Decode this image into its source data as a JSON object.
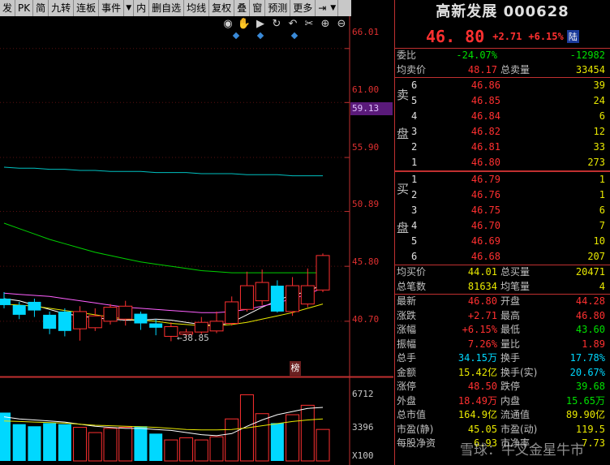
{
  "toolbar": {
    "items": [
      "发",
      "PK",
      "简",
      "九转",
      "连板",
      "事件",
      "内",
      "删自选",
      "均线",
      "复权",
      "叠",
      "窗",
      "预测",
      "更多"
    ],
    "dropdown_glyph": "▼",
    "pin_icon": "pin-icon"
  },
  "chart_tools": {
    "icons": [
      "eye-icon",
      "hand-icon",
      "play-icon",
      "replay-icon",
      "undo-icon",
      "scissors-icon",
      "zoom-in-icon",
      "zoom-out-icon"
    ]
  },
  "chart_data": [
    {
      "type": "candlestick",
      "price_ticks": [
        "66.01",
        "61.00",
        "55.90",
        "50.89",
        "45.80",
        "40.70"
      ],
      "ylim": [
        37.0,
        67.5
      ],
      "current_price_label": "59.13",
      "low_marker_label": "←38.85",
      "event_badge": "榜",
      "candles": [
        {
          "o": 42.8,
          "c": 42.2,
          "h": 43.4,
          "l": 41.9
        },
        {
          "o": 42.2,
          "c": 41.3,
          "h": 42.5,
          "l": 40.9
        },
        {
          "o": 42.5,
          "c": 41.7,
          "h": 42.8,
          "l": 41.1
        },
        {
          "o": 41.3,
          "c": 40.0,
          "h": 41.6,
          "l": 39.5
        },
        {
          "o": 41.6,
          "c": 39.8,
          "h": 41.9,
          "l": 39.3
        },
        {
          "o": 40.0,
          "c": 41.6,
          "h": 42.1,
          "l": 38.9
        },
        {
          "o": 40.1,
          "c": 41.2,
          "h": 41.9,
          "l": 39.8
        },
        {
          "o": 40.7,
          "c": 42.0,
          "h": 42.3,
          "l": 40.4
        },
        {
          "o": 40.9,
          "c": 42.1,
          "h": 42.6,
          "l": 40.3
        },
        {
          "o": 41.4,
          "c": 40.5,
          "h": 41.6,
          "l": 39.9
        },
        {
          "o": 40.5,
          "c": 40.1,
          "h": 40.9,
          "l": 39.4
        },
        {
          "o": 39.3,
          "c": 40.2,
          "h": 40.6,
          "l": 38.85
        },
        {
          "o": 39.5,
          "c": 39.7,
          "h": 40.0,
          "l": 39.1
        },
        {
          "o": 39.7,
          "c": 40.6,
          "h": 41.1,
          "l": 39.5
        },
        {
          "o": 39.8,
          "c": 40.7,
          "h": 41.6,
          "l": 39.6
        },
        {
          "o": 40.5,
          "c": 42.5,
          "h": 43.0,
          "l": 40.3
        },
        {
          "o": 41.8,
          "c": 44.0,
          "h": 45.3,
          "l": 41.6
        },
        {
          "o": 42.6,
          "c": 44.3,
          "h": 45.5,
          "l": 42.2
        },
        {
          "o": 44.0,
          "c": 41.6,
          "h": 44.5,
          "l": 41.5
        },
        {
          "o": 41.6,
          "c": 44.0,
          "h": 44.8,
          "l": 41.2
        },
        {
          "o": 42.3,
          "c": 44.0,
          "h": 45.6,
          "l": 42.0
        },
        {
          "o": 43.6,
          "c": 46.8,
          "h": 47.0,
          "l": 43.4
        }
      ],
      "moving_averages": [
        {
          "name": "MA5",
          "color": "#ffffff",
          "values": [
            42.8,
            42.6,
            42.2,
            41.8,
            41.4,
            41.2,
            41.0,
            40.9,
            40.8,
            40.8,
            40.9,
            40.8,
            40.6,
            40.4,
            40.3,
            40.6,
            41.3,
            42.0,
            42.6,
            43.2,
            43.4,
            44.2
          ]
        },
        {
          "name": "MA10",
          "color": "#e8e800",
          "values": [
            42.3,
            42.2,
            42.1,
            41.9,
            41.7,
            41.5,
            41.3,
            41.1,
            40.9,
            40.8,
            40.7,
            40.5,
            40.4,
            40.3,
            40.3,
            40.4,
            40.6,
            40.9,
            41.2,
            41.5,
            41.9,
            42.3
          ]
        },
        {
          "name": "MA20",
          "color": "#ff60ff",
          "values": [
            43.3,
            43.2,
            43.1,
            43.0,
            42.8,
            42.6,
            42.4,
            42.2,
            42.0,
            41.9,
            41.8,
            41.7,
            41.6,
            41.5,
            41.5,
            41.6,
            41.8,
            42.1,
            42.4,
            42.8,
            43.2,
            43.8
          ]
        },
        {
          "name": "MA60",
          "color": "#00d000",
          "values": [
            49.8,
            49.3,
            48.8,
            48.3,
            47.9,
            47.5,
            47.1,
            46.8,
            46.5,
            46.2,
            46.0,
            45.8,
            45.6,
            45.4,
            45.3,
            45.2,
            45.2,
            45.2,
            45.2,
            45.2,
            45.2,
            45.2
          ]
        },
        {
          "name": "MA120",
          "color": "#00c0c0",
          "values": [
            55.0,
            54.9,
            54.9,
            54.8,
            54.8,
            54.7,
            54.7,
            54.6,
            54.6,
            54.6,
            54.5,
            54.5,
            54.5,
            54.4,
            54.4,
            54.4,
            54.3,
            54.3,
            54.3,
            54.2,
            54.2,
            54.2
          ]
        }
      ]
    },
    {
      "type": "bar",
      "ticks": [
        "6712",
        "3396"
      ],
      "unit_label": "X100",
      "ylim": [
        0,
        7800
      ],
      "values": [
        4600,
        3500,
        3300,
        3600,
        3500,
        3200,
        2700,
        3100,
        3200,
        3300,
        2600,
        2000,
        2200,
        2000,
        2300,
        4000,
        6300,
        4500,
        3600,
        4400,
        5300,
        3000
      ],
      "ma_lines": [
        {
          "color": "#ffffff",
          "values": [
            4200,
            4000,
            3900,
            3800,
            3700,
            3500,
            3300,
            3200,
            3100,
            3100,
            3000,
            2900,
            2700,
            2500,
            2400,
            2600,
            3300,
            3900,
            4400,
            4700,
            5000,
            5100
          ]
        },
        {
          "color": "#e8e800",
          "values": [
            3800,
            3750,
            3700,
            3650,
            3600,
            3500,
            3400,
            3350,
            3300,
            3250,
            3200,
            3100,
            3000,
            2950,
            2950,
            3000,
            3150,
            3350,
            3550,
            3750,
            3900,
            4000
          ]
        }
      ]
    }
  ],
  "stock": {
    "name": "高新发展",
    "code": "000628",
    "last_price": "46. 80",
    "change": "+2.71",
    "change_pct": "+6.15%",
    "market_badge": "陆"
  },
  "summary_rows": [
    {
      "label": "委比",
      "value1": "-24.07%",
      "label2": "",
      "value2": "-12982"
    },
    {
      "label": "均卖价",
      "value1": "48.17",
      "label2": "总卖量",
      "value2": "33454"
    }
  ],
  "sell_label": [
    "卖",
    "盘"
  ],
  "buy_label": [
    "买",
    "盘"
  ],
  "sell_orders": [
    {
      "level": "6",
      "price": "46.86",
      "volume": "39"
    },
    {
      "level": "5",
      "price": "46.85",
      "volume": "24"
    },
    {
      "level": "4",
      "price": "46.84",
      "volume": "6"
    },
    {
      "level": "3",
      "price": "46.82",
      "volume": "12"
    },
    {
      "level": "2",
      "price": "46.81",
      "volume": "33"
    },
    {
      "level": "1",
      "price": "46.80",
      "volume": "273"
    }
  ],
  "buy_orders": [
    {
      "level": "1",
      "price": "46.79",
      "volume": "1"
    },
    {
      "level": "2",
      "price": "46.76",
      "volume": "1"
    },
    {
      "level": "3",
      "price": "46.75",
      "volume": "6"
    },
    {
      "level": "4",
      "price": "46.70",
      "volume": "7"
    },
    {
      "level": "5",
      "price": "46.69",
      "volume": "10"
    },
    {
      "level": "6",
      "price": "46.68",
      "volume": "207"
    }
  ],
  "buy_summary": [
    {
      "label": "均买价",
      "value1": "44.01",
      "label2": "总买量",
      "value2": "20471"
    },
    {
      "label": "总笔数",
      "value1": "81634",
      "label2": "均笔量",
      "value2": "4"
    }
  ],
  "stats": [
    {
      "label": "最新",
      "value1": "46.80",
      "label2": "开盘",
      "value2": "44.28"
    },
    {
      "label": "涨跌",
      "value1": "+2.71",
      "label2": "最高",
      "value2": "46.80"
    },
    {
      "label": "涨幅",
      "value1": "+6.15%",
      "label2": "最低",
      "value2": "43.60"
    },
    {
      "label": "振幅",
      "value1": "7.26%",
      "label2": "量比",
      "value2": "1.89"
    },
    {
      "label": "总手",
      "value1": "34.15万",
      "label2": "换手",
      "value2": "17.78%"
    },
    {
      "label": "金额",
      "value1": "15.42亿",
      "label2": "换手(实)",
      "value2": "20.67%"
    },
    {
      "label": "涨停",
      "value1": "48.50",
      "label2": "跌停",
      "value2": "39.68"
    },
    {
      "label": "外盘",
      "value1": "18.49万",
      "label2": "内盘",
      "value2": "15.65万"
    },
    {
      "label": "总市值",
      "value1": "164.9亿",
      "label2": "流通值",
      "value2": "89.90亿"
    },
    {
      "label": "市盈(静)",
      "value1": "45.05",
      "label2": "市盈(动)",
      "value2": "119.5"
    },
    {
      "label": "每股净资",
      "value1": "6.93",
      "label2": "市净率",
      "value2": "7.73"
    }
  ],
  "watermark": "雪球：牛叉金星牛市",
  "colors": {
    "up": "#ff3030",
    "down": "#00d8ff",
    "neutral": "#e0e0e0",
    "accent": "#c03030"
  }
}
